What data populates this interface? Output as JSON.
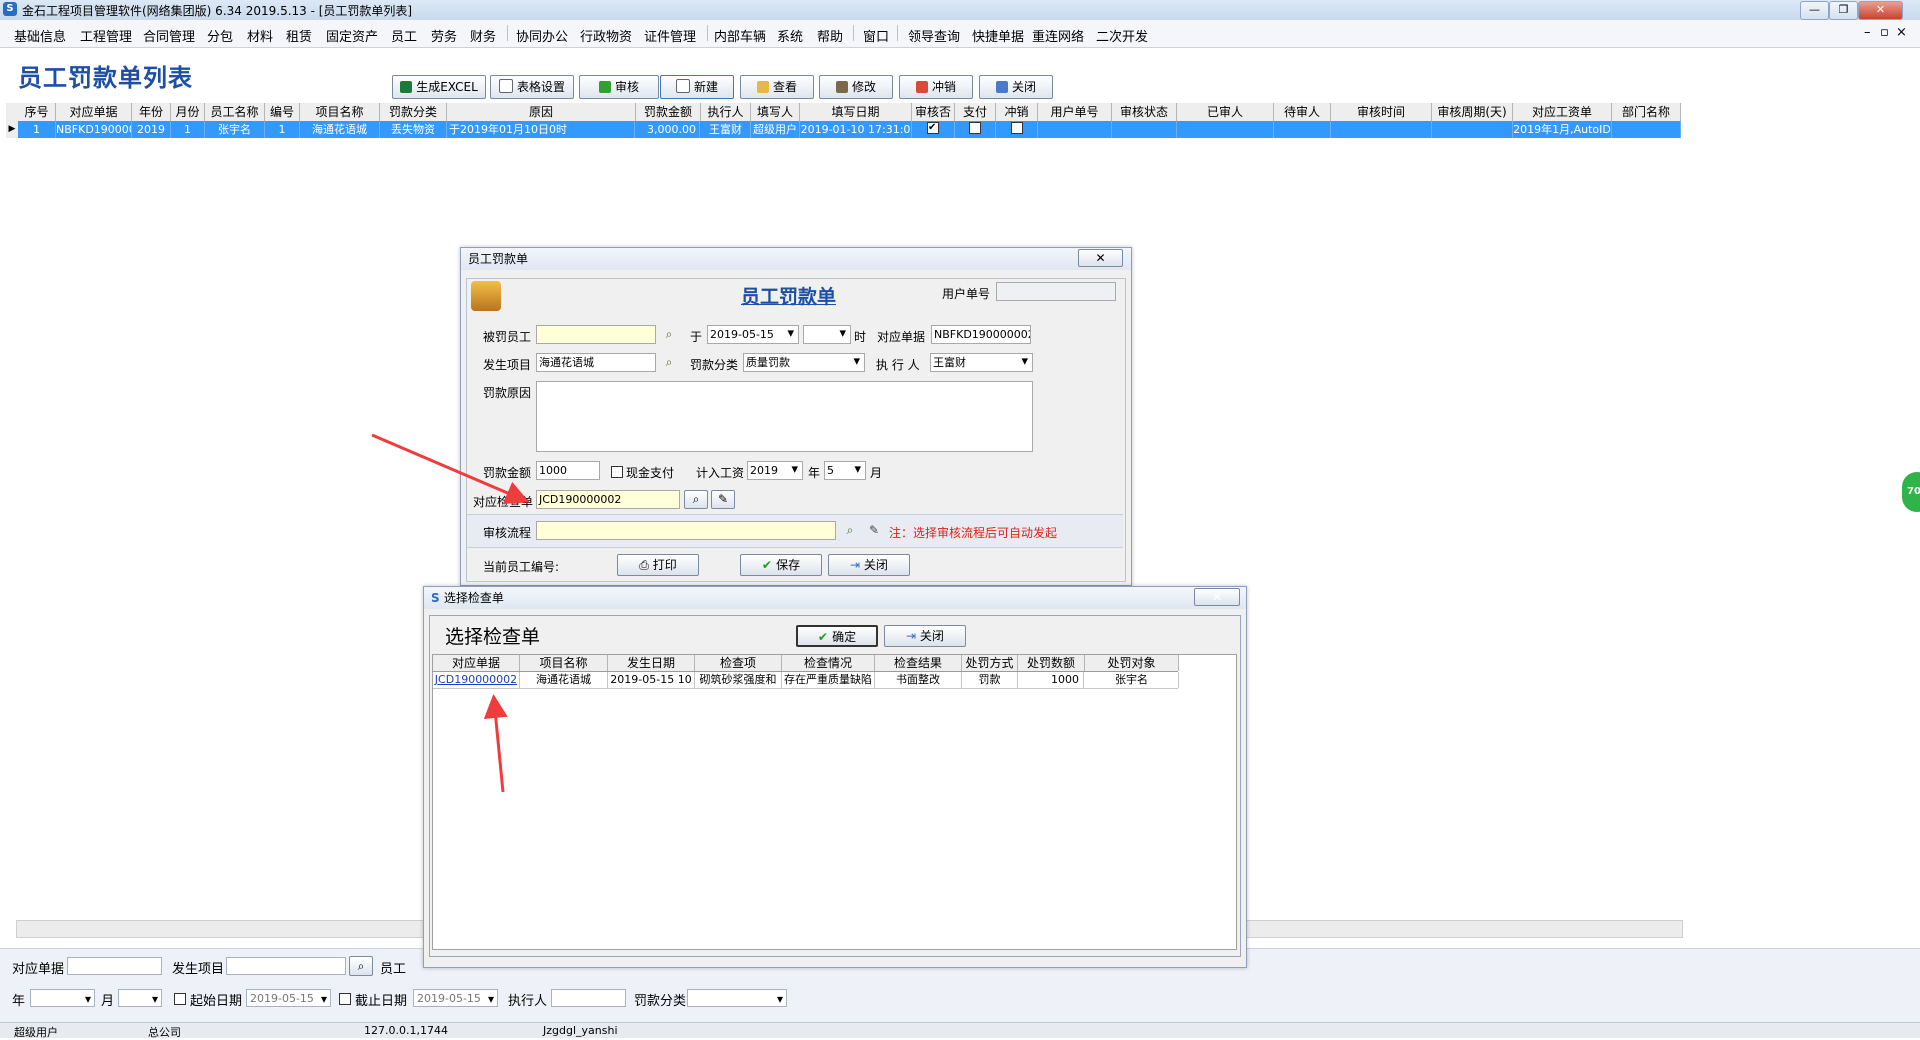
{
  "window": {
    "title": "金石工程项目管理软件(网络集团版) 6.34  2019.5.13 - [员工罚款单列表]",
    "logo_letter": "S",
    "controls": [
      "—",
      "❐",
      "✕"
    ]
  },
  "menu": [
    "基础信息",
    "工程管理",
    "合同管理",
    "分包",
    "材料",
    "租赁",
    "固定资产",
    "员工",
    "劳务",
    "财务",
    "协同办公",
    "行政物资",
    "证件管理",
    "内部车辆",
    "系统",
    "帮助",
    "窗口",
    "领导查询",
    "快捷单据",
    "重连网络",
    "二次开发"
  ],
  "mdi_controls": [
    "–",
    "▫",
    "×"
  ],
  "page": {
    "title": "员工罚款单列表",
    "toolbar": [
      "生成EXCEL",
      "表格设置",
      "审核",
      "新建",
      "查看",
      "修改",
      "冲销",
      "关闭"
    ]
  },
  "grid": {
    "columns": [
      "序号",
      "对应单据",
      "年份",
      "月份",
      "员工名称",
      "编号",
      "项目名称",
      "罚款分类",
      "原因",
      "罚款金额",
      "执行人",
      "填写人",
      "填写日期",
      "审核否",
      "支付",
      "冲销",
      "用户单号",
      "审核状态",
      "已审人",
      "待审人",
      "审核时间",
      "审核周期(天)",
      "对应工资单",
      "部门名称"
    ],
    "row": {
      "indicator": "▶",
      "seq": "1",
      "doc": "NBFKD1900000",
      "year": "2019",
      "month": "1",
      "employee": "张宇名",
      "code": "1",
      "project": "海通花语城",
      "category": "丢失物资",
      "reason": "于2019年01月10日0时",
      "amount": "3,000.00",
      "executor": "王富财",
      "writer": "超级用户",
      "date": "2019-01-10 17:31:0",
      "payroll": "2019年1月,AutoID"
    }
  },
  "filter": {
    "doc_label": "对应单据",
    "project_label": "发生项目",
    "employee_label": "员工",
    "year_label": "年",
    "month_label": "月",
    "start_label": "起始日期",
    "start_value": "2019-05-15",
    "end_label": "截止日期",
    "end_value": "2019-05-15",
    "executor_label": "执行人",
    "category_label": "罚款分类"
  },
  "status": [
    "超级用户",
    "总公司",
    "127.0.0.1,1744",
    "Jzgdgl_yanshi"
  ],
  "side_bubble": "70",
  "fine_dialog": {
    "title": "员工罚款单",
    "heading": "员工罚款单",
    "user_no_label": "用户单号",
    "employee_label": "被罚员工",
    "at_label": "于",
    "date_value": "2019-05-15",
    "hour_label": "时",
    "doc_label": "对应单据",
    "doc_value": "NBFKD190000002",
    "project_label": "发生项目",
    "project_value": "海通花语城",
    "category_label": "罚款分类",
    "category_value": "质量罚款",
    "executor_label": "执 行 人",
    "executor_value": "王富财",
    "reason_label": "罚款原因",
    "amount_label": "罚款金额",
    "amount_value": "1000",
    "cash_label": "现金支付",
    "salary_label": "计入工资",
    "salary_year": "2019",
    "year_unit": "年",
    "salary_month": "5",
    "month_unit": "月",
    "check_label": "对应检查单",
    "check_value": "JCD190000002",
    "flow_label": "审核流程",
    "flow_note": "注：选择审核流程后可自动发起",
    "emp_no_label": "当前员工编号:",
    "print": "打印",
    "save": "保存",
    "close": "关闭"
  },
  "select_dialog": {
    "title": "选择检查单",
    "heading": "选择检查单",
    "ok": "确定",
    "close": "关闭",
    "columns": [
      "对应单据",
      "项目名称",
      "发生日期",
      "检查项",
      "检查情况",
      "检查结果",
      "处罚方式",
      "处罚数额",
      "处罚对象"
    ],
    "row": [
      "JCD190000002",
      "海通花语城",
      "2019-05-15 10",
      "砌筑砂浆强度和",
      "存在严重质量缺陷",
      "书面整改",
      "罚款",
      "1000",
      "张宇名"
    ]
  },
  "colors": {
    "accent": "#1c4fa5",
    "selection": "#3399ff",
    "note_red": "#e02020",
    "arrow_red": "#f03c3c"
  }
}
